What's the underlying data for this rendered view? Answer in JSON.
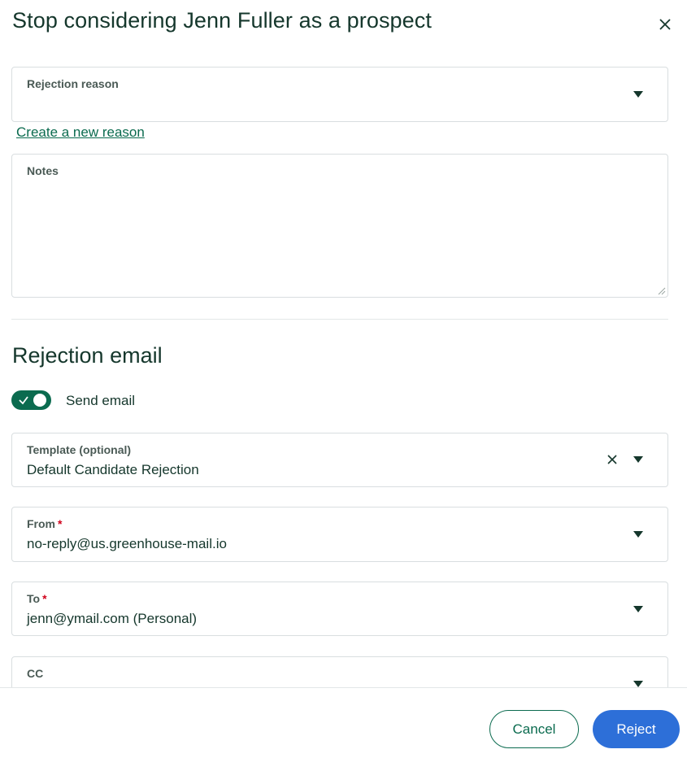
{
  "dialog": {
    "title": "Stop considering Jenn Fuller as a prospect",
    "close_icon": "close-icon"
  },
  "rejection_reason": {
    "label": "Rejection reason",
    "value": "",
    "create_link": "Create a new reason"
  },
  "notes": {
    "label": "Notes",
    "value": ""
  },
  "rejection_email": {
    "heading": "Rejection email",
    "send_email": {
      "label": "Send email",
      "enabled": true
    },
    "template": {
      "label": "Template (optional)",
      "value": "Default Candidate Rejection"
    },
    "from": {
      "label": "From",
      "required_mark": "*",
      "value": "no-reply@us.greenhouse-mail.io"
    },
    "to": {
      "label": "To",
      "required_mark": "*",
      "value": "jenn@ymail.com (Personal)"
    },
    "cc": {
      "label": "CC",
      "value": ""
    }
  },
  "footer": {
    "cancel_label": "Cancel",
    "reject_label": "Reject"
  },
  "colors": {
    "accent_green": "#0b6b4f",
    "primary_blue": "#2d6fd8",
    "text_dark": "#15372c",
    "required_red": "#d0021b"
  }
}
